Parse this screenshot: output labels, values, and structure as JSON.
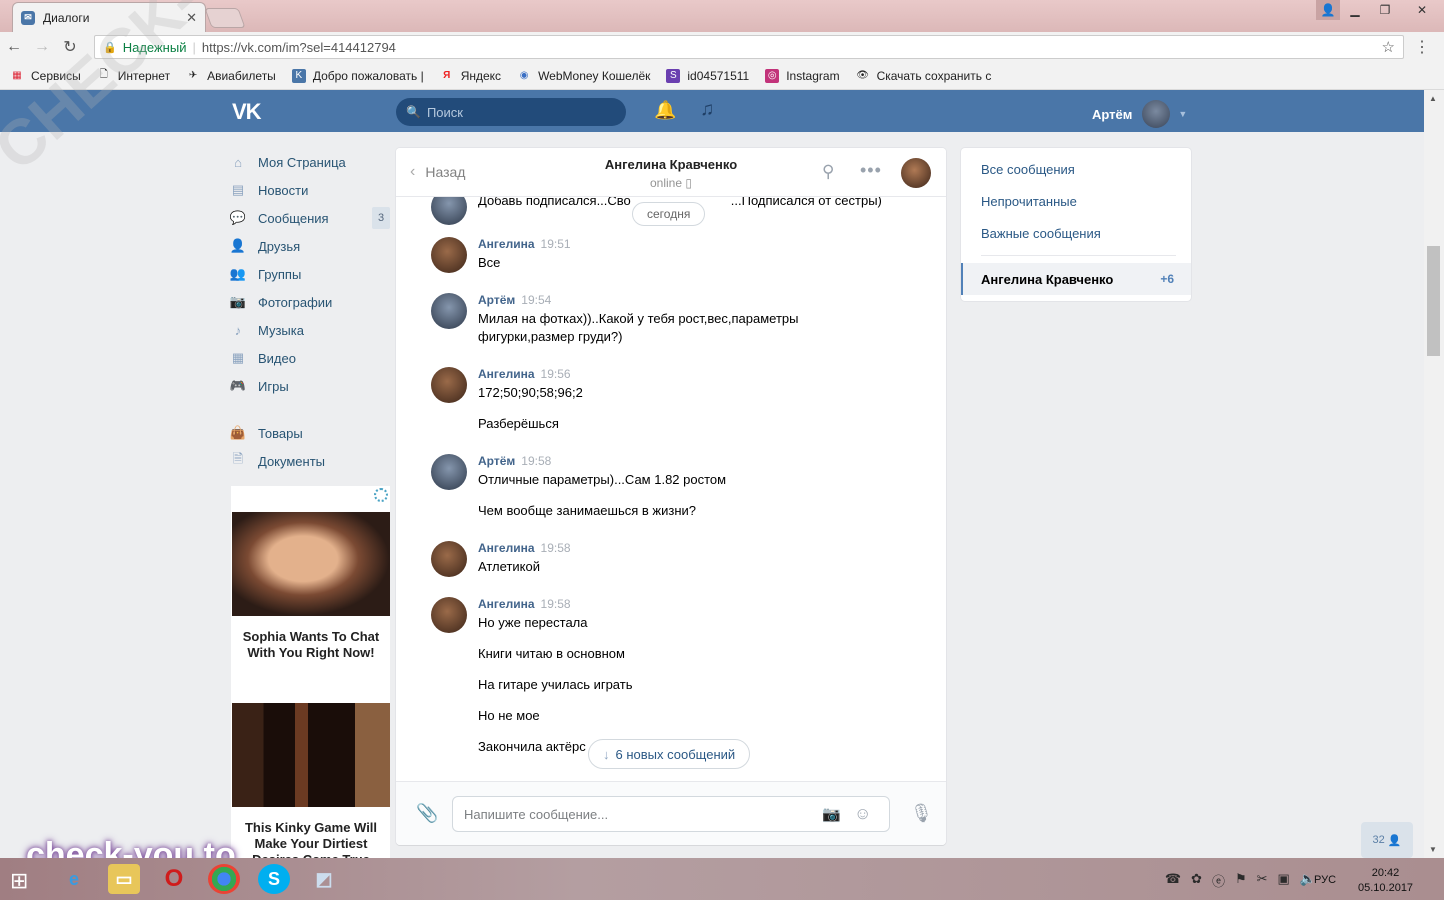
{
  "browser": {
    "tab_title": "Диалоги",
    "secure_label": "Надежный",
    "url": "https://vk.com/im?sel=414412794",
    "bookmarks": [
      {
        "label": "Сервисы",
        "icon": "apps-grid-icon"
      },
      {
        "label": "Интернет",
        "icon": "page-icon"
      },
      {
        "label": "Авиабилеты",
        "icon": "plane-icon"
      },
      {
        "label": "Добро пожаловать |",
        "icon": "vk-icon"
      },
      {
        "label": "Яндекс",
        "icon": "yandex-icon"
      },
      {
        "label": "WebMoney Кошелёк",
        "icon": "webmoney-icon"
      },
      {
        "label": "id04571511",
        "icon": "s-icon"
      },
      {
        "label": "Instagram",
        "icon": "instagram-icon"
      },
      {
        "label": "Скачать сохранить с",
        "icon": "eye-icon"
      }
    ]
  },
  "vk": {
    "logo": "VK",
    "search_placeholder": "Поиск",
    "user_name": "Артём"
  },
  "left_menu": {
    "items": [
      {
        "label": "Моя Страница",
        "icon": "home-icon"
      },
      {
        "label": "Новости",
        "icon": "news-icon"
      },
      {
        "label": "Сообщения",
        "icon": "messages-icon",
        "badge": "3"
      },
      {
        "label": "Друзья",
        "icon": "friends-icon"
      },
      {
        "label": "Группы",
        "icon": "groups-icon"
      },
      {
        "label": "Фотографии",
        "icon": "camera-icon"
      },
      {
        "label": "Музыка",
        "icon": "music-icon"
      },
      {
        "label": "Видео",
        "icon": "video-icon"
      },
      {
        "label": "Игры",
        "icon": "games-icon"
      }
    ],
    "secondary": [
      {
        "label": "Товары",
        "icon": "bag-icon"
      },
      {
        "label": "Документы",
        "icon": "document-icon"
      }
    ]
  },
  "ads": {
    "ad1": "Sophia Wants To Chat With You Right Now!",
    "ad2": "This Kinky Game Will Make Your Dirtiest Desires Come True"
  },
  "chat": {
    "back_label": "Назад",
    "peer_name": "Ангелина Кравченко",
    "peer_status": "online",
    "date_pill": "сегодня",
    "new_messages": "6 новых сообщений",
    "input_placeholder": "Напишите сообщение...",
    "top_partial": "Добавь подписался...Сво",
    "top_partial_tail": "...Подписался от сестры)",
    "messages": [
      {
        "author": "Ангелина",
        "time": "19:51",
        "lines": [
          "Все"
        ]
      },
      {
        "author": "Артём",
        "time": "19:54",
        "lines": [
          "Милая на фотках))..Какой у тебя рост,вес,параметры фигурки,размер груди?)"
        ]
      },
      {
        "author": "Ангелина",
        "time": "19:56",
        "lines": [
          "172;50;90;58;96;2",
          "Разберёшься"
        ]
      },
      {
        "author": "Артём",
        "time": "19:58",
        "lines": [
          "Отличные параметры)...Сам 1.82 ростом",
          "Чем вообще занимаешься в жизни?"
        ]
      },
      {
        "author": "Ангелина",
        "time": "19:58",
        "lines": [
          "Атлетикой"
        ]
      },
      {
        "author": "Ангелина",
        "time": "19:58",
        "lines": [
          "Но уже перестала",
          "Книги читаю в основном",
          "На гитаре училась играть",
          "Но не мое",
          "Закончила актёрс"
        ]
      }
    ]
  },
  "right_panel": {
    "all_messages": "Все сообщения",
    "unread": "Непрочитанные",
    "important": "Важные сообщения",
    "active_dialog": "Ангелина Кравченко",
    "active_count": "+6"
  },
  "online_count": "32",
  "watermark": {
    "diagonal": "CHECK-YOU.ME",
    "bottom": "check-you.to"
  },
  "taskbar": {
    "lang": "РУС",
    "time": "20:42",
    "date": "05.10.2017"
  },
  "colors": {
    "vk_blue": "#4a76a8",
    "link": "#2a5885",
    "name": "#42648b"
  }
}
